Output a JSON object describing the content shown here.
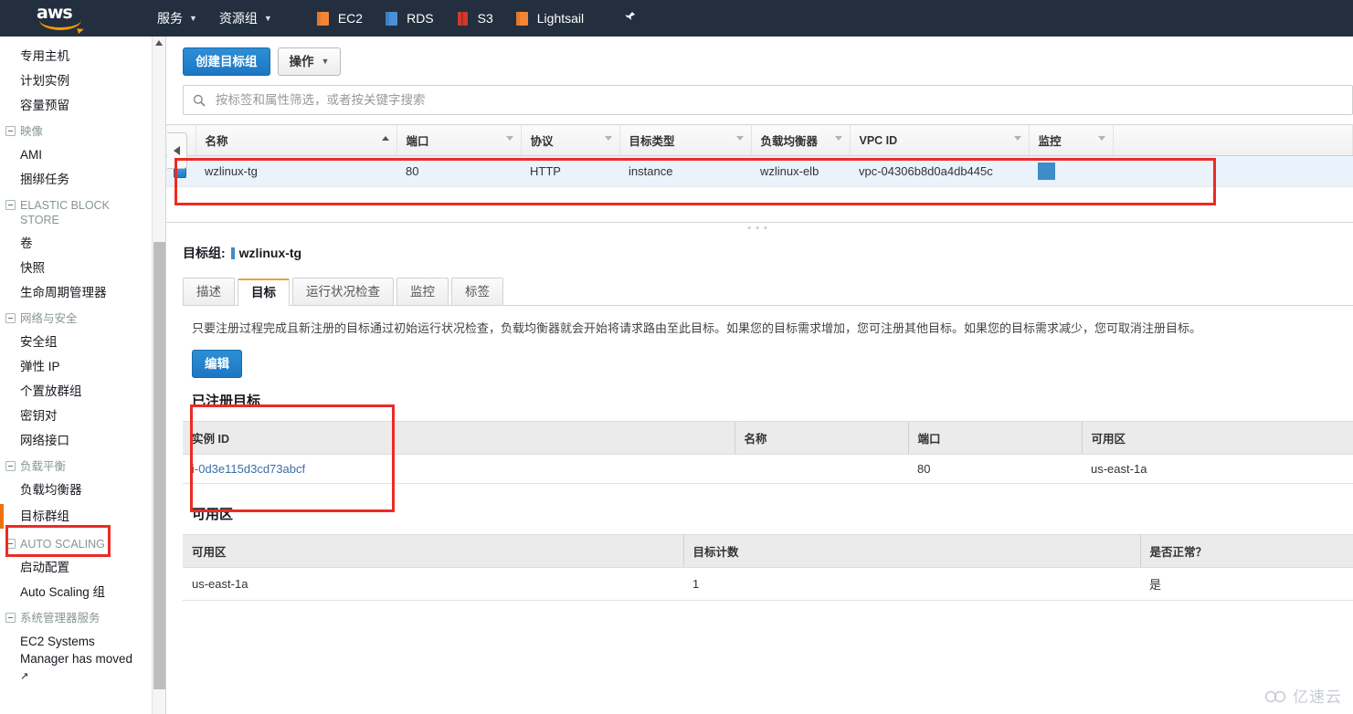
{
  "topnav": {
    "logo_text": "aws",
    "items": [
      {
        "label": "服务",
        "caret": true,
        "icon": null
      },
      {
        "label": "资源组",
        "caret": true,
        "icon": null
      }
    ],
    "services": [
      {
        "label": "EC2",
        "icon": "ec2-cube-icon",
        "color": "#f58536"
      },
      {
        "label": "RDS",
        "icon": "rds-database-icon",
        "color": "#4a90d9"
      },
      {
        "label": "S3",
        "icon": "s3-bucket-icon",
        "color": "#cf3a2e"
      },
      {
        "label": "Lightsail",
        "icon": "lightsail-icon",
        "color": "#f58536"
      }
    ],
    "pin_icon": "pin-icon"
  },
  "sidebar": {
    "items": [
      {
        "label": "专用主机",
        "type": "link"
      },
      {
        "label": "计划实例",
        "type": "link"
      },
      {
        "label": "容量预留",
        "type": "link"
      },
      {
        "label": "映像",
        "type": "group"
      },
      {
        "label": "AMI",
        "type": "link"
      },
      {
        "label": "捆绑任务",
        "type": "link"
      },
      {
        "label": "ELASTIC BLOCK STORE",
        "type": "group"
      },
      {
        "label": "卷",
        "type": "link"
      },
      {
        "label": "快照",
        "type": "link"
      },
      {
        "label": "生命周期管理器",
        "type": "link"
      },
      {
        "label": "网络与安全",
        "type": "group"
      },
      {
        "label": "安全组",
        "type": "link"
      },
      {
        "label": "弹性 IP",
        "type": "link"
      },
      {
        "label": "个置放群组",
        "type": "link"
      },
      {
        "label": "密钥对",
        "type": "link"
      },
      {
        "label": "网络接口",
        "type": "link"
      },
      {
        "label": "负载平衡",
        "type": "group"
      },
      {
        "label": "负载均衡器",
        "type": "link"
      },
      {
        "label": "目标群组",
        "type": "link",
        "selected": true
      },
      {
        "label": "AUTO SCALING",
        "type": "group"
      },
      {
        "label": "启动配置",
        "type": "link"
      },
      {
        "label": "Auto Scaling 组",
        "type": "link"
      },
      {
        "label": "系统管理器服务",
        "type": "group"
      },
      {
        "label": "EC2 Systems Manager has moved",
        "type": "link",
        "external": true
      }
    ],
    "collapse_handle_icon": "chevron-left-icon"
  },
  "toolbar": {
    "create_label": "创建目标组",
    "actions_label": "操作",
    "search_placeholder": "按标签和属性筛选，或者按关键字搜索",
    "search_value": ""
  },
  "target_group_table": {
    "columns": [
      "名称",
      "端口",
      "协议",
      "目标类型",
      "负载均衡器",
      "VPC ID",
      "监控"
    ],
    "sort_column": "名称",
    "sort_direction": "asc",
    "rows": [
      {
        "selected": true,
        "name": "wzlinux-tg",
        "port": "80",
        "protocol": "HTTP",
        "target_type": "instance",
        "load_balancer": "wzlinux-elb",
        "vpc_id": "vpc-04306b8d0a4db445c",
        "monitoring": "monitoring-swatch"
      }
    ]
  },
  "detail": {
    "label": "目标组:",
    "name": "wzlinux-tg",
    "tabs": [
      {
        "label": "描述",
        "active": false
      },
      {
        "label": "目标",
        "active": true
      },
      {
        "label": "运行状况检查",
        "active": false
      },
      {
        "label": "监控",
        "active": false
      },
      {
        "label": "标签",
        "active": false
      }
    ],
    "description": "只要注册过程完成且新注册的目标通过初始运行状况检查，负载均衡器就会开始将请求路由至此目标。如果您的目标需求增加，您可注册其他目标。如果您的目标需求减少，您可取消注册目标。",
    "edit_label": "编辑",
    "registered_targets": {
      "title": "已注册目标",
      "columns": [
        "实例 ID",
        "名称",
        "端口",
        "可用区"
      ],
      "rows": [
        {
          "instance_id": "i-0d3e115d3cd73abcf",
          "name": "",
          "port": "80",
          "az": "us-east-1a"
        }
      ]
    },
    "availability_zones": {
      "title": "可用区",
      "columns": [
        "可用区",
        "目标计数",
        "是否正常？"
      ],
      "rows": [
        {
          "az": "us-east-1a",
          "target_count": "1",
          "healthy": "是"
        }
      ]
    }
  },
  "watermark": {
    "text": "亿速云",
    "icon": "cloud-icon"
  },
  "colors": {
    "nav_bg": "#232f3e",
    "accent_orange": "#ec7211",
    "primary_blue": "#1d76c4",
    "annotation_red": "#ee2a24",
    "row_selected": "#eaf2fb"
  }
}
